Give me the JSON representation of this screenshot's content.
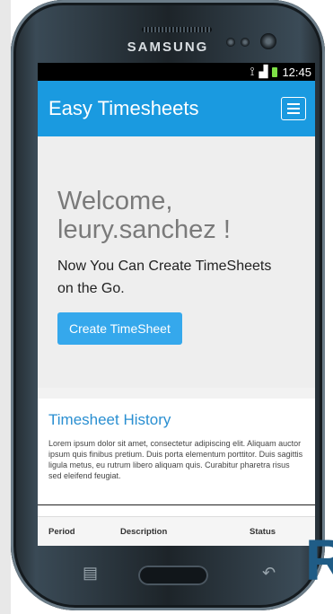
{
  "device": {
    "brand": "SAMSUNG"
  },
  "status_bar": {
    "time": "12:45",
    "signal_icon": "signal-icon",
    "wifi_icon": "wifi-icon"
  },
  "app_bar": {
    "title": "Easy Timesheets",
    "menu_icon": "hamburger-menu-icon"
  },
  "welcome": {
    "greeting": "Welcome,",
    "username": "leury.sanchez !",
    "tagline_line1": "Now You Can Create TimeSheets",
    "tagline_line2": "on the Go.",
    "create_button": "Create TimeSheet"
  },
  "history": {
    "title": "Timesheet History",
    "body": "Lorem ipsum dolor sit amet, consectetur adipiscing elit. Aliquam auctor ipsum quis finibus pretium. Duis porta elementum porttitor. Duis sagittis ligula metus, eu rutrum libero aliquam quis. Curabitur pharetra risus sed eleifend feugiat."
  },
  "table": {
    "columns": [
      "Period",
      "Description",
      "Status"
    ]
  },
  "side_letter": "R",
  "colors": {
    "app_bar": "#1a9ae0",
    "button": "#35a8ec",
    "history_title": "#2a8fd1"
  }
}
